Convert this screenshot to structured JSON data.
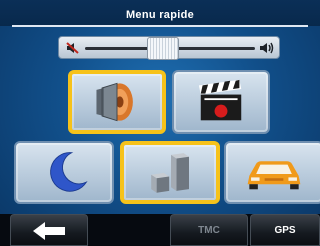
{
  "header": {
    "title": "Menu rapide"
  },
  "volume": {
    "level": 0.45,
    "mute_icon": "speaker-mute-icon",
    "loud_icon": "speaker-loud-icon"
  },
  "tiles": [
    {
      "id": "sound",
      "icon": "speaker-icon",
      "selected": true
    },
    {
      "id": "video",
      "icon": "clapperboard-icon",
      "selected": false
    },
    {
      "id": "night",
      "icon": "crescent-moon-icon",
      "selected": false
    },
    {
      "id": "buildings",
      "icon": "3d-buildings-icon",
      "selected": true
    },
    {
      "id": "vehicle",
      "icon": "car-icon",
      "selected": false
    }
  ],
  "bottom": {
    "back_icon": "back-arrow-icon",
    "tmc_label": "TMC",
    "gps_label": "GPS"
  },
  "colors": {
    "selection": "#f6c21a",
    "background": "#114f8a"
  }
}
